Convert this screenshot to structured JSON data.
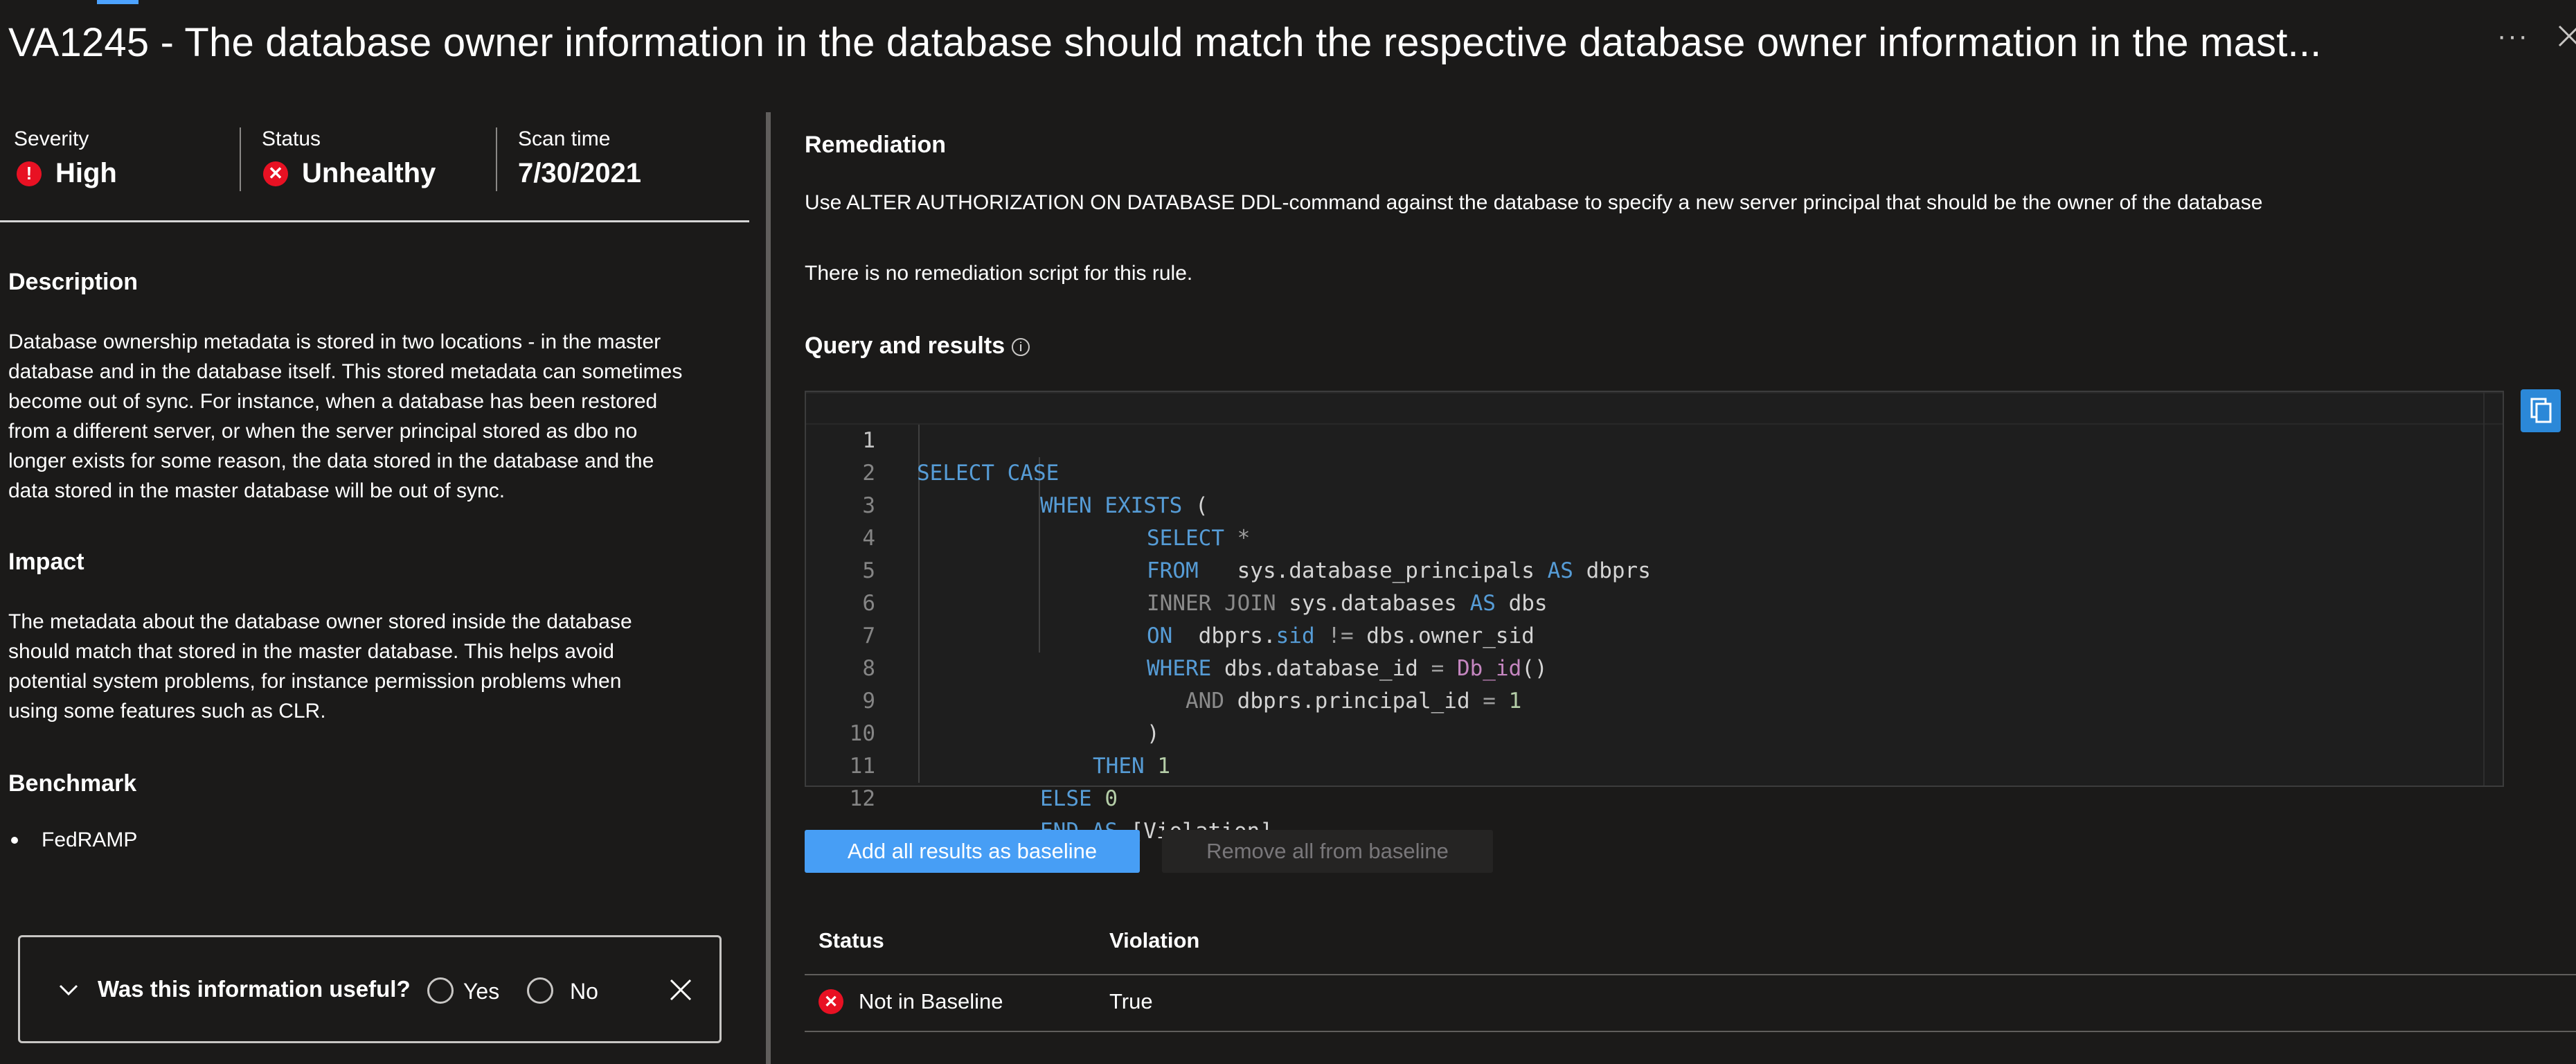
{
  "header": {
    "title": "VA1245 - The database owner information in the database should match the respective database owner information in the mast...",
    "more_label": "···"
  },
  "meta": {
    "severity_label": "Severity",
    "severity_value": "High",
    "status_label": "Status",
    "status_value": "Unhealthy",
    "scan_label": "Scan time",
    "scan_value": "7/30/2021"
  },
  "description": {
    "heading": "Description",
    "lines": [
      "Database ownership metadata is stored in two locations - in the master",
      "database and in the database itself. This stored metadata can sometimes",
      "become out of sync. For instance, when a database has been restored",
      "from a different server, or when the server principal stored as dbo no",
      "longer exists for some reason, the data stored in the database and the",
      "data stored in the master database will be out of sync."
    ]
  },
  "impact": {
    "heading": "Impact",
    "lines": [
      "The metadata about the database owner stored inside the database",
      "should match that stored in the master database. This helps avoid",
      "potential system problems, for instance permission problems when",
      "using some features such as CLR."
    ]
  },
  "benchmark": {
    "heading": "Benchmark",
    "items": [
      "FedRAMP"
    ]
  },
  "feedback": {
    "question": "Was this information useful?",
    "yes": "Yes",
    "no": "No"
  },
  "remediation": {
    "heading": "Remediation",
    "text": "Use ALTER AUTHORIZATION ON DATABASE DDL-command against the database to specify a new server principal that should be the owner of the database",
    "script_note": "There is no remediation script for this rule."
  },
  "query": {
    "heading": "Query and results",
    "line_numbers": [
      "1",
      "2",
      "3",
      "4",
      "5",
      "6",
      "7",
      "8",
      "9",
      "10",
      "11",
      "12"
    ],
    "l1_kw": "SELECT CASE",
    "l2_kw": "WHEN EXISTS",
    "l2_paren": " (",
    "l3_kw": "SELECT",
    "l3_star": " *",
    "l4_kw": "FROM",
    "l4_t1": "   sys.database_principals ",
    "l4_as": "AS",
    "l4_t2": " dbprs",
    "l5_kw": "INNER JOIN",
    "l5_t1": " sys.databases ",
    "l5_as": "AS",
    "l5_t2": " dbs",
    "l6_kw": "ON",
    "l6_t1": "  dbprs.",
    "l6_sid": "sid",
    "l6_op": " != ",
    "l6_t2": "dbs.owner_sid",
    "l7_kw": "WHERE",
    "l7_t1": " dbs.database_id ",
    "l7_op": "=",
    "l7_sp": " ",
    "l7_fn": "Db_id",
    "l7_paren": "()",
    "l8_kw": "AND",
    "l8_t1": " dbprs.principal_id ",
    "l8_op": "=",
    "l8_sp": " ",
    "l8_num": "1",
    "l9_t": ")",
    "l10_kw": "THEN",
    "l10_sp": " ",
    "l10_num": "1",
    "l11_kw": "ELSE",
    "l11_sp": " ",
    "l11_num": "0",
    "l12_kw": "END AS",
    "l12_t": " [Violation]"
  },
  "actions": {
    "add_baseline": "Add all results as baseline",
    "remove_baseline": "Remove all from baseline"
  },
  "results": {
    "columns": [
      "Status",
      "Violation"
    ],
    "rows": [
      {
        "status": "Not in Baseline",
        "violation": "True"
      }
    ]
  },
  "colors": {
    "accent": "#479ef5",
    "error": "#e81123",
    "keyword": "#569cd6",
    "function": "#c586c0",
    "number": "#b5cea8"
  },
  "icons": [
    "more-icon",
    "close-icon",
    "severity-high-icon",
    "unhealthy-icon",
    "info-icon",
    "copy-icon",
    "chevron-down-icon",
    "radio-icon",
    "not-in-baseline-icon"
  ]
}
